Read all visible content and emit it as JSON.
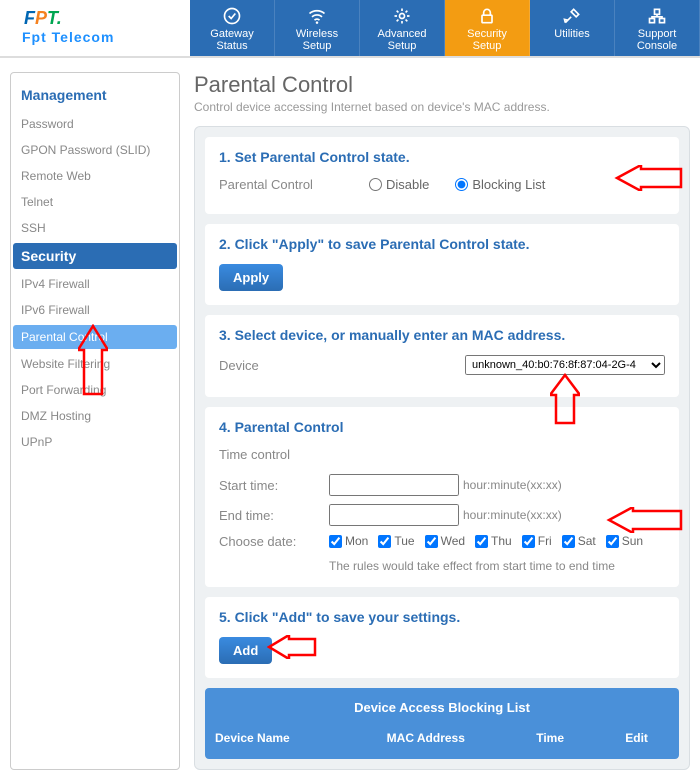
{
  "brand": {
    "name": "Fpt Telecom",
    "logoLetters": [
      "F",
      "P",
      "T"
    ]
  },
  "nav": [
    {
      "l1": "Gateway",
      "l2": "Status"
    },
    {
      "l1": "Wireless",
      "l2": "Setup"
    },
    {
      "l1": "Advanced",
      "l2": "Setup"
    },
    {
      "l1": "Security",
      "l2": "Setup"
    },
    {
      "l1": "Utilities",
      "l2": ""
    },
    {
      "l1": "Support",
      "l2": "Console"
    }
  ],
  "sidebar": {
    "group1": "Management",
    "items1": [
      "Password",
      "GPON Password (SLID)",
      "Remote Web",
      "Telnet",
      "SSH"
    ],
    "group2": "Security",
    "items2": [
      "IPv4 Firewall",
      "IPv6 Firewall",
      "Parental Control",
      "Website Filtering",
      "Port Forwarding",
      "DMZ Hosting",
      "UPnP"
    ]
  },
  "page": {
    "title": "Parental Control",
    "subtitle": "Control device accessing Internet based on device's MAC address."
  },
  "step1": {
    "title": "1. Set Parental Control state.",
    "label": "Parental Control",
    "opt_disable": "Disable",
    "opt_blocking": "Blocking List"
  },
  "step2": {
    "title": "2. Click \"Apply\" to save Parental Control state.",
    "btn": "Apply"
  },
  "step3": {
    "title": "3. Select device, or manually enter an MAC address.",
    "label": "Device",
    "selected": "unknown_40:b0:76:8f:87:04-2G-4"
  },
  "step4": {
    "title": "4. Parental Control",
    "section": "Time control",
    "start": "Start time:",
    "end": "End time:",
    "hint": "hour:minute(xx:xx)",
    "choose": "Choose date:",
    "days": [
      "Mon",
      "Tue",
      "Wed",
      "Thu",
      "Fri",
      "Sat",
      "Sun"
    ],
    "note": "The rules would take effect from start time to end time"
  },
  "step5": {
    "title": "5. Click \"Add\" to save your settings.",
    "btn": "Add"
  },
  "blocklist": {
    "title": "Device Access Blocking List",
    "cols": [
      "Device Name",
      "MAC Address",
      "Time",
      "Edit"
    ]
  }
}
